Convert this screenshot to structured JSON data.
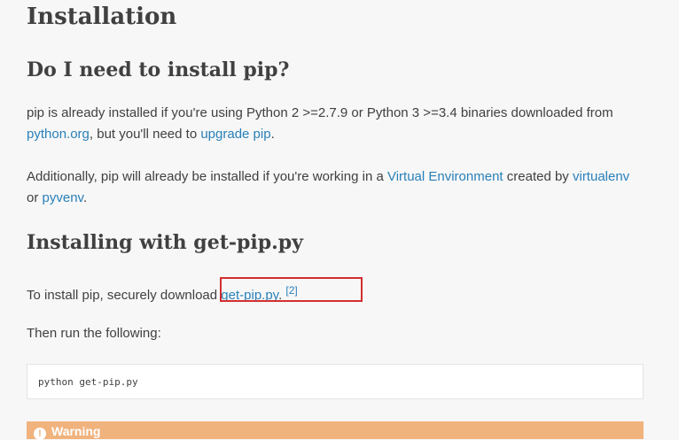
{
  "headings": {
    "installation": "Installation",
    "do_i_need": "Do I need to install pip?",
    "installing_with": "Installing with get-pip.py"
  },
  "para1": {
    "text1": "pip is already installed if you're using Python 2 >=2.7.9 or Python 3 >=3.4 binaries downloaded from ",
    "link_python_org": "python.org",
    "text2": ", but you'll need to ",
    "link_upgrade_pip": "upgrade pip",
    "text3": "."
  },
  "para2": {
    "text1": "Additionally, pip will already be installed if you're working in a ",
    "link_virtual_env": "Virtual Environment",
    "text2": " created by ",
    "link_virtualenv": "virtualenv",
    "text3": " or ",
    "link_pyvenv": "pyvenv",
    "text4": "."
  },
  "para3": {
    "text1": "To install pip, securely download ",
    "link_get_pip": "get-pip.py",
    "text2": ". ",
    "footnote": "[2]"
  },
  "para4": {
    "text": "Then run the following:"
  },
  "code": {
    "line": "python get-pip.py"
  },
  "warning": {
    "icon": "!",
    "title": "Warning"
  },
  "colors": {
    "link": "#2980b9",
    "text": "#404040",
    "background": "#f7f7f7",
    "warning_bg": "#f0b37e",
    "highlight_box": "#d32f2f"
  }
}
